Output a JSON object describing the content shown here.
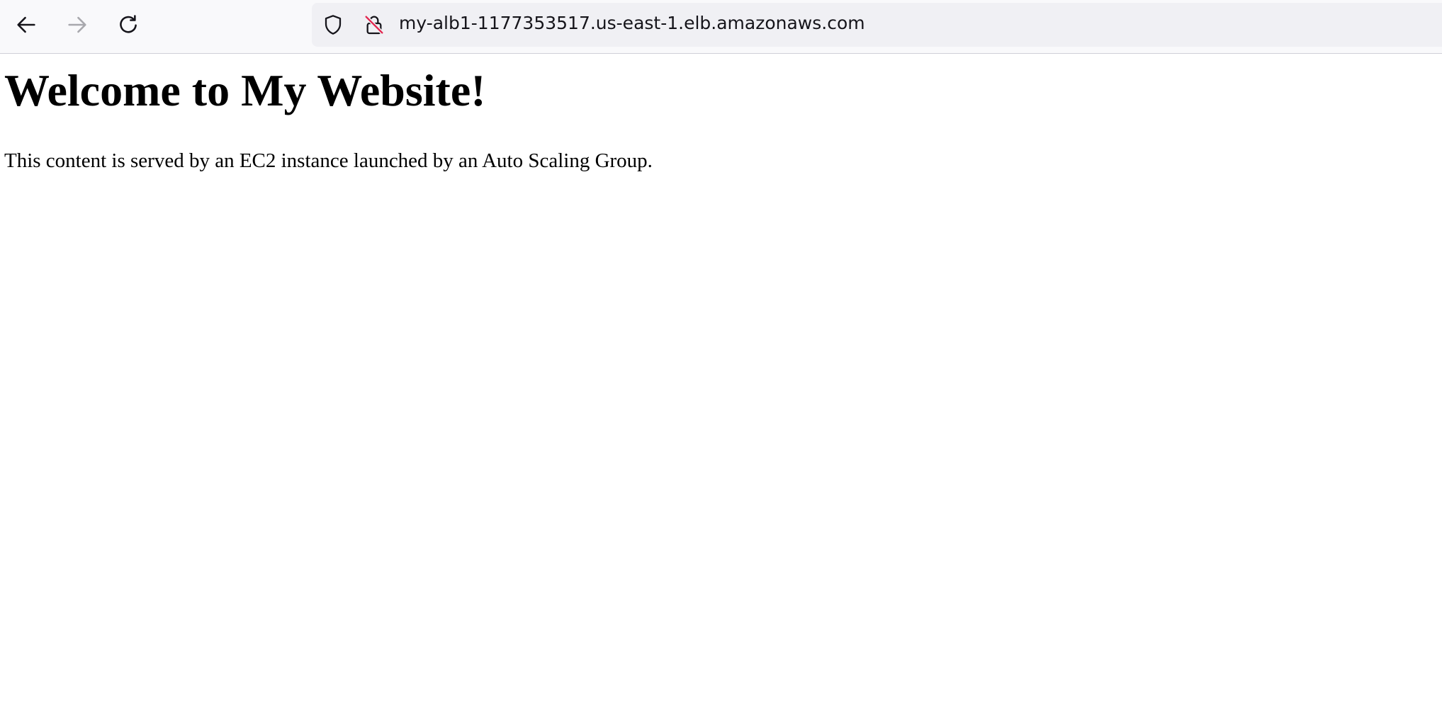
{
  "browser": {
    "url": "my-alb1-1177353517.us-east-1.elb.amazonaws.com",
    "icons": {
      "back": "arrow-left-icon",
      "forward": "arrow-right-icon",
      "reload": "reload-icon",
      "tracking_protection": "shield-icon",
      "connection": "insecure-lock-icon"
    },
    "colors": {
      "toolbar_bg": "#f9f9fb",
      "urlbar_bg": "#f0f0f4",
      "insecure_slash": "#e22850"
    }
  },
  "page": {
    "heading": "Welcome to My Website!",
    "body": "This content is served by an EC2 instance launched by an Auto Scaling Group."
  }
}
